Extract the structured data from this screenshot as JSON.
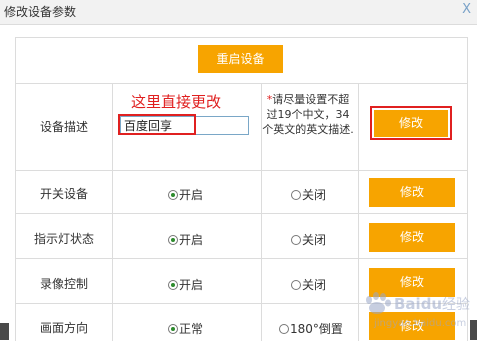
{
  "window": {
    "title": "修改设备参数",
    "close_glyph": "X"
  },
  "restart_button": "重启设备",
  "annotation": "这里直接更改",
  "device_description": {
    "label": "设备描述",
    "input_value": "百度回享",
    "note_star": "*",
    "note_text": "请尽量设置不超过19个中文，34个英文的英文描述.",
    "button": "修改"
  },
  "rows": [
    {
      "label": "开关设备",
      "option1": "开启",
      "option2": "关闭",
      "selected": "option1",
      "button": "修改"
    },
    {
      "label": "指示灯状态",
      "option1": "开启",
      "option2": "关闭",
      "selected": "option1",
      "button": "修改"
    },
    {
      "label": "录像控制",
      "option1": "开启",
      "option2": "关闭",
      "selected": "option1",
      "button": "修改"
    },
    {
      "label": "画面方向",
      "option1": "正常",
      "option2": "180°倒置",
      "selected": "option1",
      "button": "修改"
    }
  ],
  "watermark": {
    "brand": "Baidu",
    "text": "经验",
    "url": "jingyan.baidu.com"
  },
  "colors": {
    "accent": "#f7a400",
    "highlight": "#e02020",
    "radio_selected": "#2e8b2e",
    "border": "#dcdcdc"
  }
}
